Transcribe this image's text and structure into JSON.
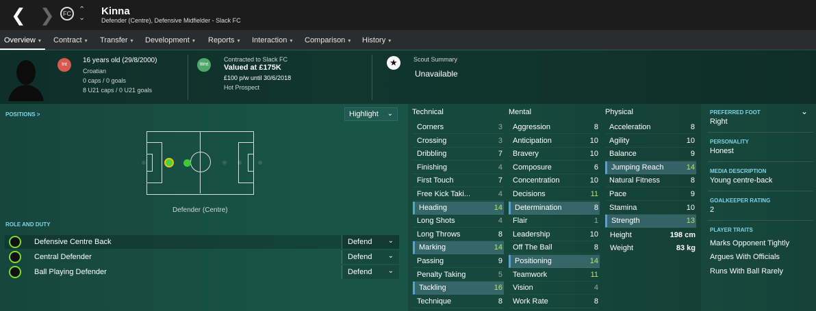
{
  "player": {
    "name": "Kinna",
    "subtitle": "Defender (Centre), Defensive Midfielder - Slack FC"
  },
  "nav": {
    "back": "❮",
    "forward": "❯",
    "badge": "FC",
    "up": "⌃",
    "down": "⌄"
  },
  "tabs": [
    {
      "label": "Overview"
    },
    {
      "label": "Contract"
    },
    {
      "label": "Transfer"
    },
    {
      "label": "Development"
    },
    {
      "label": "Reports"
    },
    {
      "label": "Interaction"
    },
    {
      "label": "Comparison"
    },
    {
      "label": "History"
    }
  ],
  "profile": {
    "int_badge": "Int",
    "age": "16 years old (29/8/2000)",
    "nationality": "Croatian",
    "caps": "0 caps / 0 goals",
    "u21": "8 U21 caps / 0 U21 goals"
  },
  "contract": {
    "badge": "Wnt",
    "contracted": "Contracted to Slack FC",
    "value": "Valued at £175K",
    "wage": "£100 p/w until 30/6/2018",
    "status": "Hot Prospect"
  },
  "scout": {
    "title": "Scout Summary",
    "value": "Unavailable"
  },
  "positions": {
    "label": "POSITIONS >",
    "highlight": "Highlight",
    "current": "Defender (Centre)"
  },
  "roles": {
    "label": "ROLE AND DUTY",
    "items": [
      {
        "name": "Defensive Centre Back",
        "duty": "Defend"
      },
      {
        "name": "Central Defender",
        "duty": "Defend"
      },
      {
        "name": "Ball Playing Defender",
        "duty": "Defend"
      }
    ]
  },
  "technical": {
    "title": "Technical",
    "attrs": [
      {
        "name": "Corners",
        "value": "3"
      },
      {
        "name": "Crossing",
        "value": "3"
      },
      {
        "name": "Dribbling",
        "value": "7"
      },
      {
        "name": "Finishing",
        "value": "4"
      },
      {
        "name": "First Touch",
        "value": "7"
      },
      {
        "name": "Free Kick Taki...",
        "value": "4"
      },
      {
        "name": "Heading",
        "value": "14"
      },
      {
        "name": "Long Shots",
        "value": "4"
      },
      {
        "name": "Long Throws",
        "value": "8"
      },
      {
        "name": "Marking",
        "value": "14"
      },
      {
        "name": "Passing",
        "value": "9"
      },
      {
        "name": "Penalty Taking",
        "value": "5"
      },
      {
        "name": "Tackling",
        "value": "16"
      },
      {
        "name": "Technique",
        "value": "8"
      }
    ]
  },
  "mental": {
    "title": "Mental",
    "attrs": [
      {
        "name": "Aggression",
        "value": "8"
      },
      {
        "name": "Anticipation",
        "value": "10"
      },
      {
        "name": "Bravery",
        "value": "10"
      },
      {
        "name": "Composure",
        "value": "6"
      },
      {
        "name": "Concentration",
        "value": "10"
      },
      {
        "name": "Decisions",
        "value": "11"
      },
      {
        "name": "Determination",
        "value": "8"
      },
      {
        "name": "Flair",
        "value": "1"
      },
      {
        "name": "Leadership",
        "value": "10"
      },
      {
        "name": "Off The Ball",
        "value": "8"
      },
      {
        "name": "Positioning",
        "value": "14"
      },
      {
        "name": "Teamwork",
        "value": "11"
      },
      {
        "name": "Vision",
        "value": "4"
      },
      {
        "name": "Work Rate",
        "value": "8"
      }
    ]
  },
  "physical": {
    "title": "Physical",
    "attrs": [
      {
        "name": "Acceleration",
        "value": "8"
      },
      {
        "name": "Agility",
        "value": "10"
      },
      {
        "name": "Balance",
        "value": "9"
      },
      {
        "name": "Jumping Reach",
        "value": "14"
      },
      {
        "name": "Natural Fitness",
        "value": "8"
      },
      {
        "name": "Pace",
        "value": "9"
      },
      {
        "name": "Stamina",
        "value": "10"
      },
      {
        "name": "Strength",
        "value": "13"
      }
    ],
    "height_label": "Height",
    "height": "198 cm",
    "weight_label": "Weight",
    "weight": "83 kg"
  },
  "info": {
    "preferred_foot_label": "PREFERRED FOOT",
    "preferred_foot": "Right",
    "personality_label": "PERSONALITY",
    "personality": "Honest",
    "media_label": "MEDIA DESCRIPTION",
    "media": "Young centre-back",
    "gk_label": "GOALKEEPER RATING",
    "gk": "2",
    "traits_label": "PLAYER TRAITS",
    "traits": [
      "Marks Opponent Tightly",
      "Argues With Officials",
      "Runs With Ball Rarely"
    ]
  },
  "colors": {
    "good": "#b9e36a",
    "high": "#ffffff",
    "low": "#9aa8a4",
    "highlight_row": "#4f7f8e"
  }
}
